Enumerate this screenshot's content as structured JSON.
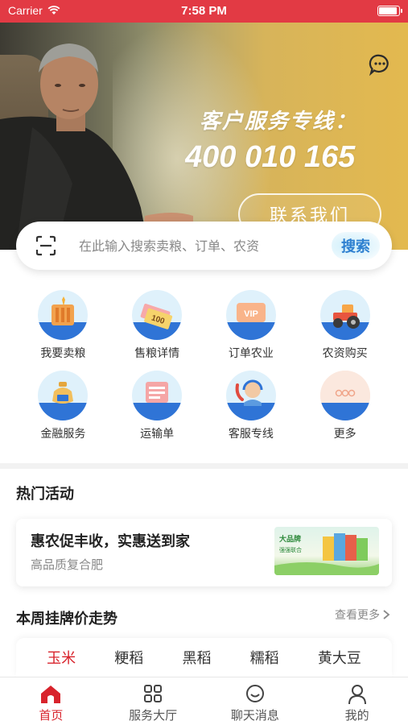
{
  "status_bar": {
    "carrier": "Carrier",
    "time": "7:58 PM"
  },
  "banner": {
    "service_title": "客户服务专线：",
    "phone": "400 010 165",
    "contact_button": "联系我们"
  },
  "search": {
    "placeholder": "在此输入搜索卖粮、订单、农资",
    "button": "搜索"
  },
  "services": [
    {
      "label": "我要卖粮",
      "icon": "grain-silo-icon"
    },
    {
      "label": "售粮详情",
      "icon": "ticket-icon"
    },
    {
      "label": "订单农业",
      "icon": "vip-card-icon"
    },
    {
      "label": "农资购买",
      "icon": "tractor-icon"
    },
    {
      "label": "金融服务",
      "icon": "money-bag-icon"
    },
    {
      "label": "运输单",
      "icon": "document-icon"
    },
    {
      "label": "客服专线",
      "icon": "customer-service-icon"
    },
    {
      "label": "更多",
      "icon": "more-icon"
    }
  ],
  "hot": {
    "title": "热门活动",
    "card_title": "惠农促丰收，实惠送到家",
    "card_subtitle": "高品质复合肥",
    "card_image_text": "大品牌 强强联合"
  },
  "price": {
    "title": "本周挂牌价走势",
    "more": "查看更多",
    "tabs": [
      "玉米",
      "粳稻",
      "黑稻",
      "糯稻",
      "黄大豆"
    ],
    "active_tab": 0
  },
  "tabbar": [
    {
      "label": "首页",
      "icon": "home-icon"
    },
    {
      "label": "服务大厅",
      "icon": "grid-icon"
    },
    {
      "label": "聊天消息",
      "icon": "chat-icon"
    },
    {
      "label": "我的",
      "icon": "person-icon"
    }
  ],
  "colors": {
    "accent": "#d8232c",
    "status_bar": "#e23a44",
    "icon_blue": "#2f74d6"
  }
}
